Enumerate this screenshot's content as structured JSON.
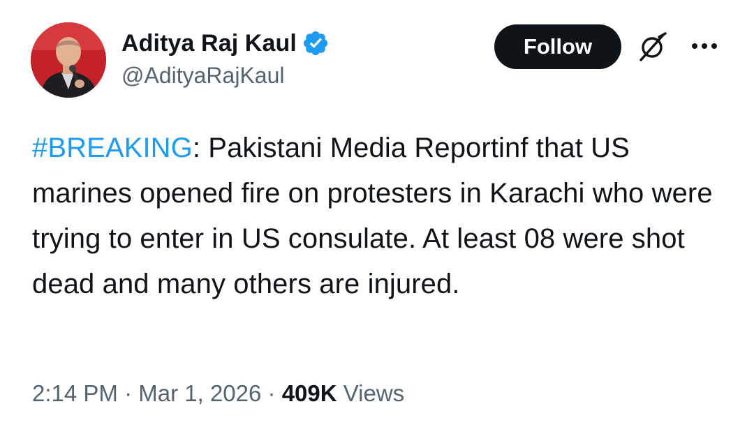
{
  "author": {
    "display_name": "Aditya Raj Kaul",
    "handle": "@AdityaRajKaul",
    "verified": true,
    "verified_color": "#1d9bf0",
    "avatar_icon": "profile-photo"
  },
  "actions": {
    "follow_label": "Follow",
    "grok_icon": "grok-icon",
    "more_icon": "more-options-icon"
  },
  "tweet": {
    "hashtag": "#BREAKING",
    "text": ": Pakistani Media Reportinf that US marines opened fire on protesters in Karachi who were trying to enter in US consulate. At least 08 were shot dead and many others are injured.",
    "hashtag_color": "#1d9bf0"
  },
  "meta": {
    "time": "2:14 PM",
    "separator": "·",
    "date": "Mar 1, 2026",
    "views_count": "409K",
    "views_label": "Views"
  },
  "colors": {
    "text_primary": "#0f1419",
    "text_secondary": "#536471",
    "follow_bg": "#0f1419",
    "follow_text": "#ffffff"
  }
}
